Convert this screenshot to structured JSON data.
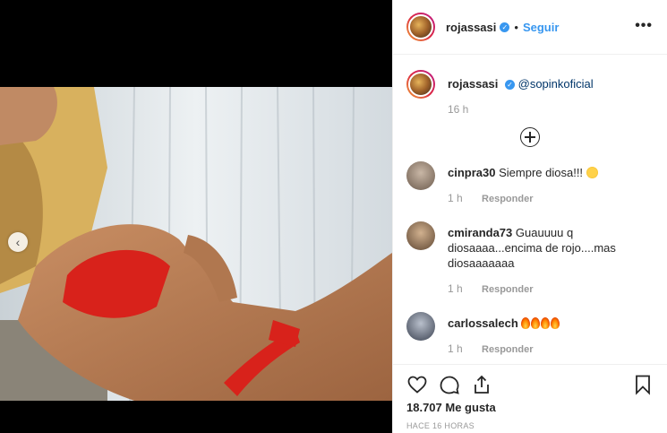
{
  "post": {
    "username": "rojassasi",
    "follow_label": "Seguir",
    "dot": "•",
    "more": "•••",
    "caption_mention": "@sopinkoficial",
    "caption_time": "16 h"
  },
  "comments": [
    {
      "username": "cinpra30",
      "text": "Siempre diosa!!!",
      "emoji": "smiling-face-with-heart-eyes",
      "time": "1 h",
      "reply": "Responder",
      "avatar_color": "#6b5a4c"
    },
    {
      "username": "cmiranda73",
      "text": "Guauuuu q diosaaaa...encima de rojo....mas diosaaaaaaa",
      "time": "1 h",
      "reply": "Responder",
      "avatar_color": "#7a5e45"
    },
    {
      "username": "carlossalech",
      "text": "",
      "fire_count": 4,
      "time": "1 h",
      "reply": "Responder",
      "avatar_color": "#4b5260"
    }
  ],
  "footer": {
    "likes_count": "18.707",
    "likes_label": "Me gusta",
    "posted": "HACE 16 HORAS"
  },
  "icons": [
    "heart-icon",
    "comment-icon",
    "share-icon",
    "bookmark-icon",
    "chevron-left-icon",
    "verified-icon",
    "plus-circle-icon"
  ],
  "colors": {
    "accent": "#3897f0",
    "mention": "#003569",
    "muted": "#999999"
  }
}
